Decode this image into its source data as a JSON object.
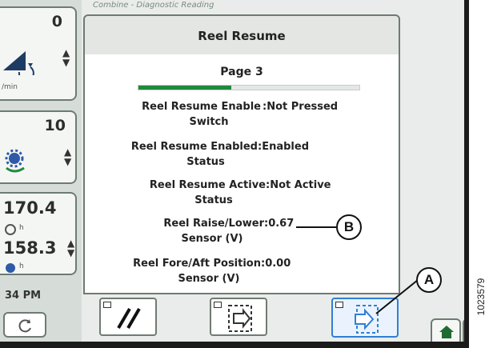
{
  "breadcrumb": "Combine - Diagnostic Reading",
  "header": {
    "title": "Reel Resume"
  },
  "page": {
    "label": "Page 3",
    "progress_fraction": 0.42
  },
  "left_panel": {
    "gauge1_value": "0",
    "gauge1_unit": "/min",
    "gauge2_value": "10",
    "gauge3_value_top": "170.4",
    "gauge3_value_bottom": "158.3",
    "unit_h": "h",
    "clock": "34 PM"
  },
  "readings": [
    {
      "label_l1": "Reel Resume Enable",
      "label_l2": "Switch",
      "value": "Not Pressed"
    },
    {
      "label_l1": "Reel Resume Enabled",
      "label_l2": "Status",
      "value": "Enabled"
    },
    {
      "label_l1": "Reel Resume Active",
      "label_l2": "Status",
      "value": "Not Active"
    },
    {
      "label_l1": "Reel Raise/Lower",
      "label_l2": "Sensor (V)",
      "value": "0.67"
    },
    {
      "label_l1": "Reel Fore/Aft Position",
      "label_l2": "Sensor (V)",
      "value": "0.00"
    }
  ],
  "separator": ":",
  "callouts": {
    "a": "A",
    "b": "B"
  },
  "figure_number": "1023579",
  "icons": {
    "updown": "up-down-arrows-icon",
    "reel": "reel-speed-icon",
    "rotation": "rotation-icon",
    "sensor": "sensor-icon",
    "reset": "reset-icon",
    "home": "home-icon",
    "exit": "exit-icon",
    "page_back": "page-back-icon",
    "page_forward": "page-forward-icon"
  },
  "colors": {
    "progress": "#1f8a3d",
    "selected_button": "#2f7fd6",
    "background": "#e9ecea"
  }
}
